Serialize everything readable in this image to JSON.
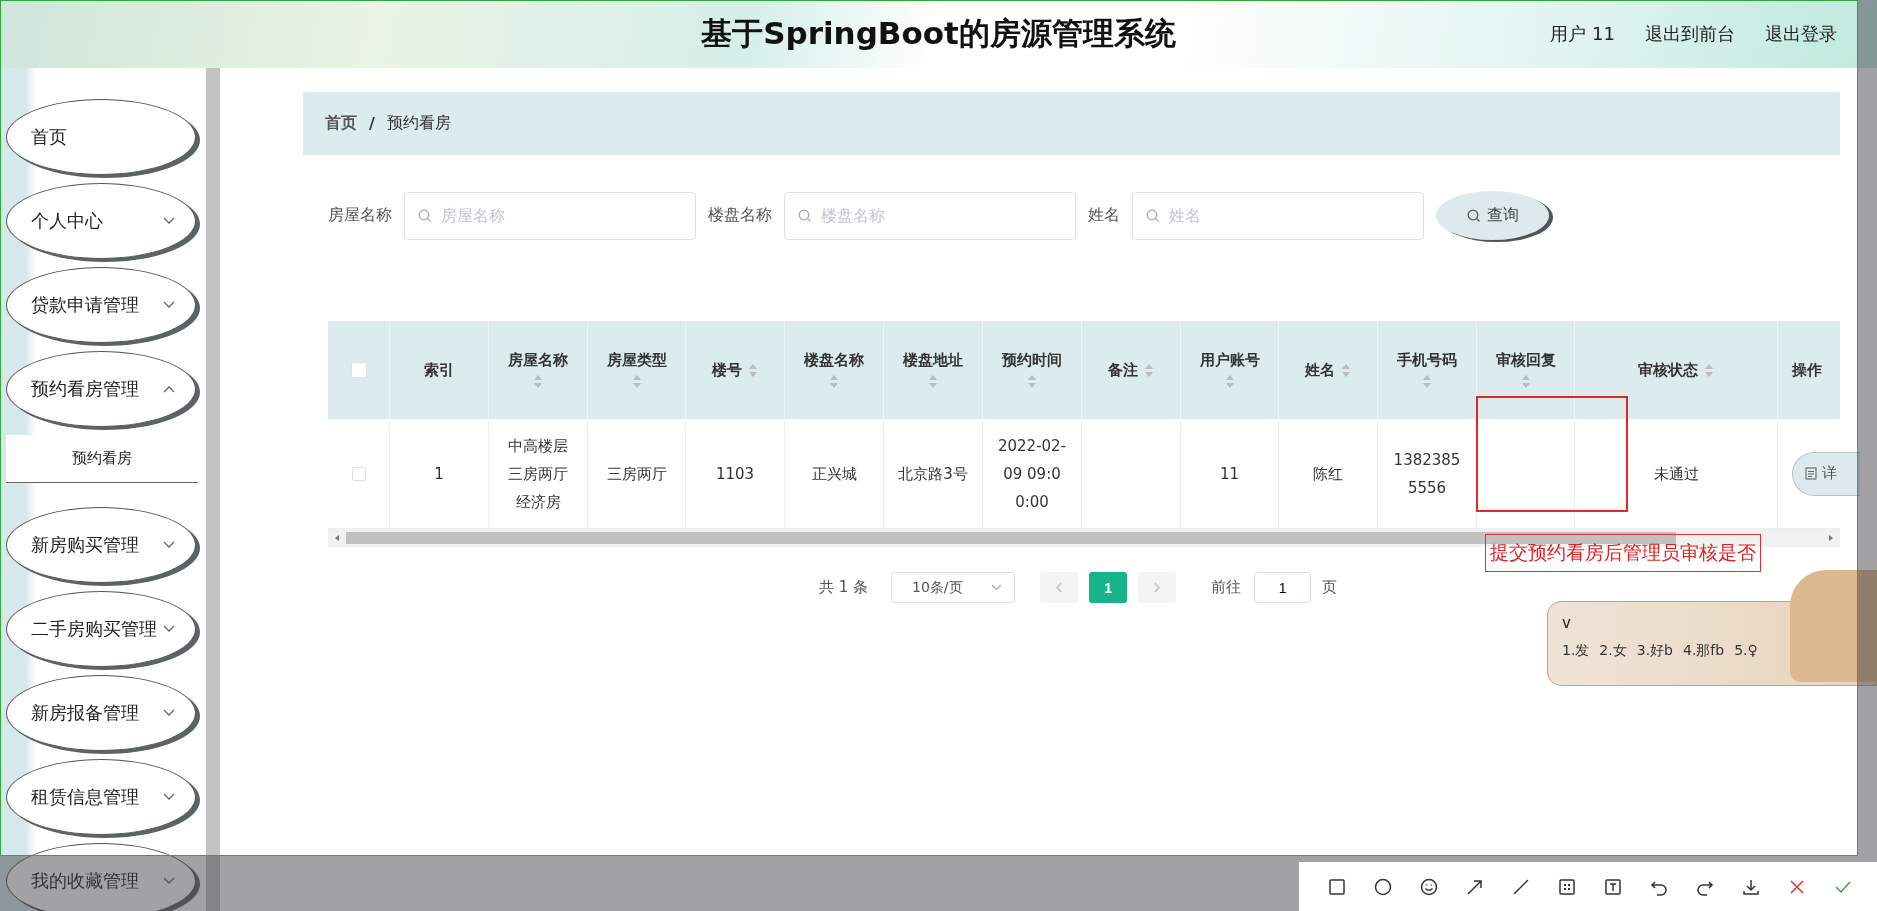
{
  "header": {
    "title": "基于SpringBoot的房源管理系统",
    "links": [
      "用户 11",
      "退出到前台",
      "退出登录"
    ]
  },
  "sidebar": {
    "items": [
      {
        "label": "首页",
        "expandable": false
      },
      {
        "label": "个人中心",
        "expandable": true,
        "expanded": false
      },
      {
        "label": "贷款申请管理",
        "expandable": true,
        "expanded": false
      },
      {
        "label": "预约看房管理",
        "expandable": true,
        "expanded": true,
        "children": [
          {
            "label": "预约看房",
            "selected": true
          }
        ]
      },
      {
        "label": "新房购买管理",
        "expandable": true,
        "expanded": false
      },
      {
        "label": "二手房购买管理",
        "expandable": true,
        "expanded": false
      },
      {
        "label": "新房报备管理",
        "expandable": true,
        "expanded": false
      },
      {
        "label": "租赁信息管理",
        "expandable": true,
        "expanded": false
      },
      {
        "label": "我的收藏管理",
        "expandable": true,
        "expanded": false
      }
    ]
  },
  "breadcrumb": {
    "items": [
      "首页",
      "预约看房"
    ],
    "separator": "/"
  },
  "search": {
    "fields": [
      {
        "label": "房屋名称",
        "placeholder": "房屋名称"
      },
      {
        "label": "楼盘名称",
        "placeholder": "楼盘名称"
      },
      {
        "label": "姓名",
        "placeholder": "姓名"
      }
    ],
    "button": "查询"
  },
  "table": {
    "select_all_checked": false,
    "columns": [
      {
        "label": "索引",
        "sortable": false
      },
      {
        "label": "房屋名称",
        "sortable": true
      },
      {
        "label": "房屋类型",
        "sortable": true
      },
      {
        "label": "楼号",
        "sortable": true
      },
      {
        "label": "楼盘名称",
        "sortable": true
      },
      {
        "label": "楼盘地址",
        "sortable": true
      },
      {
        "label": "预约时间",
        "sortable": true
      },
      {
        "label": "备注",
        "sortable": true
      },
      {
        "label": "用户账号",
        "sortable": true
      },
      {
        "label": "姓名",
        "sortable": true
      },
      {
        "label": "手机号码",
        "sortable": true
      },
      {
        "label": "审核回复",
        "sortable": true
      },
      {
        "label": "审核状态",
        "sortable": true
      },
      {
        "label": "操作",
        "sortable": false
      }
    ],
    "rows": [
      {
        "checked": false,
        "cells": [
          "1",
          "中高楼层三房两厅经济房",
          "三房两厅",
          "1103",
          "正兴城",
          "北京路3号",
          "2022-02-09 09:00:00",
          null,
          "11",
          "陈红",
          "13823855556",
          null,
          "未通过"
        ],
        "action": "详"
      }
    ]
  },
  "pagination": {
    "total": "共 1 条",
    "page_size": "10条/页",
    "pages": [
      {
        "label": "1",
        "selected": true
      }
    ],
    "goto_label": "前往",
    "goto_value": "1",
    "goto_suffix": "页"
  },
  "annotation": {
    "note": "提交预约看房后管理员审核是否"
  },
  "ime": {
    "input": "v",
    "candidates": [
      "1.发",
      "2.女",
      "3.好b",
      "4.那fb",
      "5.♀"
    ]
  }
}
